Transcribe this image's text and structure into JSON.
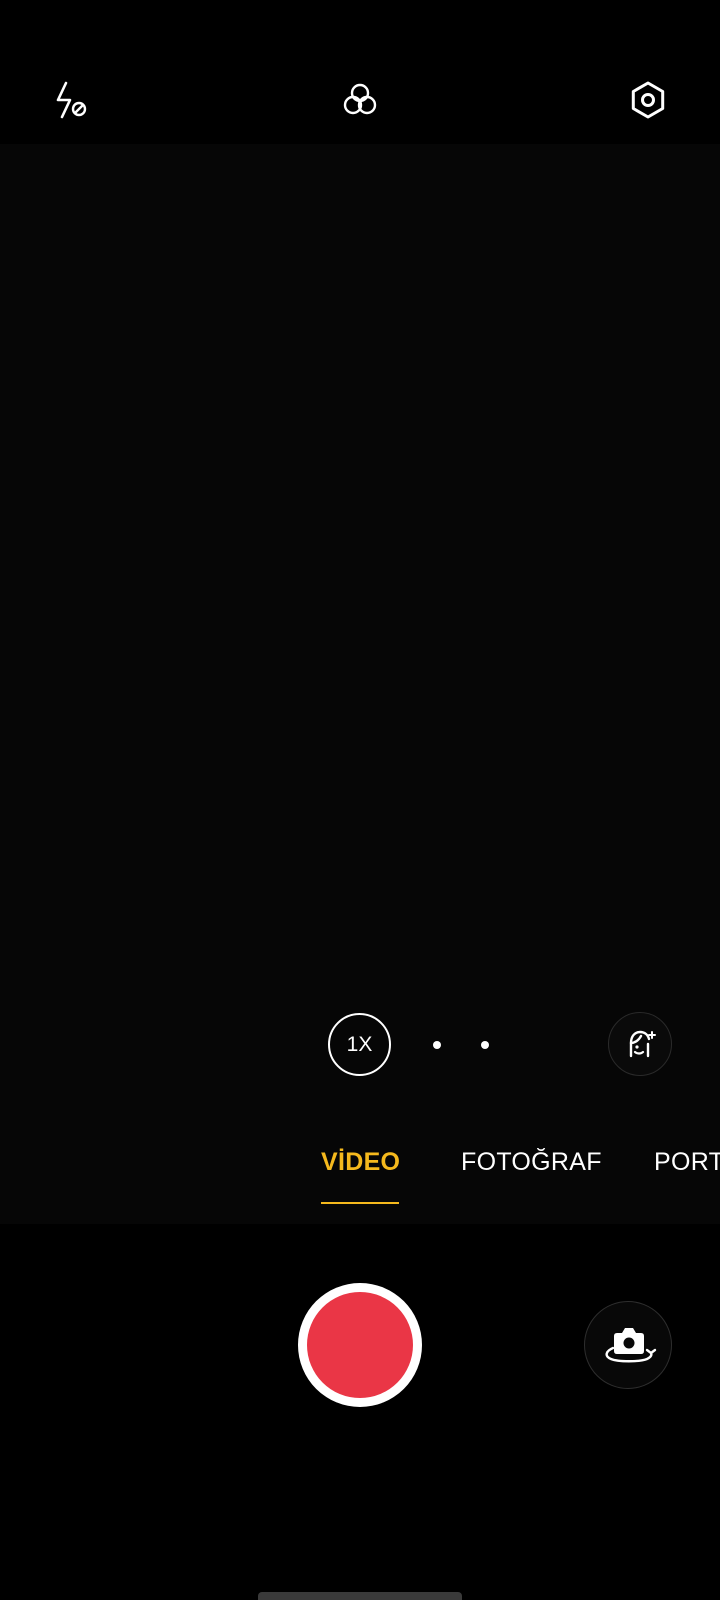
{
  "top_bar": {
    "flash_icon": "flash-off-icon",
    "filter_icon": "filter-icon",
    "settings_icon": "settings-icon"
  },
  "zoom": {
    "current_label": "1X",
    "other_levels_count_shown_as_dots": 2
  },
  "beauty": {
    "icon": "face-beauty-icon"
  },
  "modes": [
    {
      "label": "VİDEO",
      "active": true
    },
    {
      "label": "FOTOĞRAF",
      "active": false
    },
    {
      "label": "PORT",
      "active": false
    }
  ],
  "shutter": {
    "mode": "video-record",
    "color": "#ea3646"
  },
  "flip": {
    "icon": "camera-flip-icon"
  },
  "colors": {
    "accent": "#f5b91d",
    "background": "#000000",
    "record": "#ea3646"
  }
}
